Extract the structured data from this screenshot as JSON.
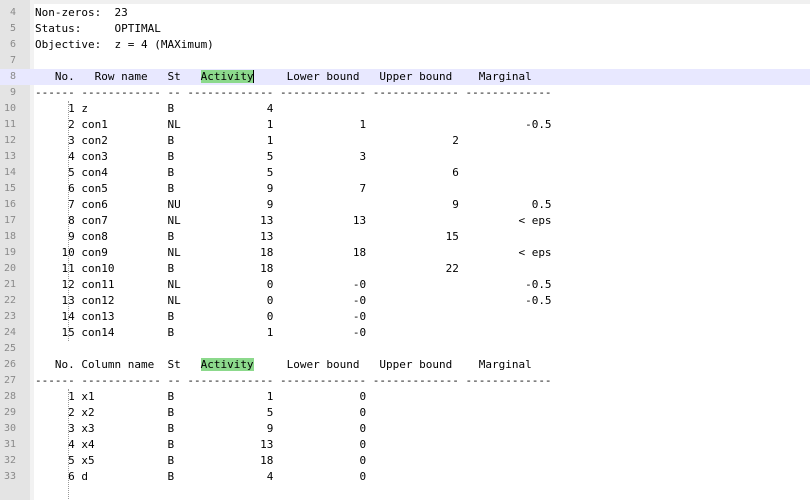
{
  "editor": {
    "header_lines": [
      {
        "n": "4",
        "text": "Non-zeros:  23"
      },
      {
        "n": "5",
        "text": "Status:     OPTIMAL"
      },
      {
        "n": "6",
        "text": "Objective:  z = 4 (MAXimum)"
      },
      {
        "n": "7",
        "text": ""
      }
    ],
    "rows_header": {
      "n": "8",
      "before": "   No.   Row name   St   ",
      "highlight": "Activity",
      "after": "     Lower bound   Upper bound    Marginal"
    },
    "rows_sep": {
      "n": "9",
      "text": "------ ------------ -- ------------- ------------- ------------- -------------"
    },
    "row_lines": [
      {
        "n": "10",
        "text": "     1 z            B              4"
      },
      {
        "n": "11",
        "text": "     2 con1         NL             1             1                        -0.5"
      },
      {
        "n": "12",
        "text": "     3 con2         B              1                           2"
      },
      {
        "n": "13",
        "text": "     4 con3         B              5             3"
      },
      {
        "n": "14",
        "text": "     5 con4         B              5                           6"
      },
      {
        "n": "15",
        "text": "     6 con5         B              9             7"
      },
      {
        "n": "16",
        "text": "     7 con6         NU             9                           9           0.5"
      },
      {
        "n": "17",
        "text": "     8 con7         NL            13            13                       < eps"
      },
      {
        "n": "18",
        "text": "     9 con8         B             13                          15"
      },
      {
        "n": "19",
        "text": "    10 con9         NL            18            18                       < eps"
      },
      {
        "n": "20",
        "text": "    11 con10        B             18                          22"
      },
      {
        "n": "21",
        "text": "    12 con11        NL             0            -0                        -0.5"
      },
      {
        "n": "22",
        "text": "    13 con12        NL             0            -0                        -0.5"
      },
      {
        "n": "23",
        "text": "    14 con13        B              0            -0"
      },
      {
        "n": "24",
        "text": "    15 con14        B              1            -0"
      },
      {
        "n": "25",
        "text": ""
      }
    ],
    "cols_header": {
      "n": "26",
      "before": "   No. Column name  St   ",
      "highlight": "Activity",
      "after": "     Lower bound   Upper bound    Marginal"
    },
    "cols_sep": {
      "n": "27",
      "text": "------ ------------ -- ------------- ------------- ------------- -------------"
    },
    "col_lines": [
      {
        "n": "28",
        "text": "     1 x1           B              1             0"
      },
      {
        "n": "29",
        "text": "     2 x2           B              5             0"
      },
      {
        "n": "30",
        "text": "     3 x3           B              9             0"
      },
      {
        "n": "31",
        "text": "     4 x4           B             13             0"
      },
      {
        "n": "32",
        "text": "     5 x5           B             18             0"
      },
      {
        "n": "33",
        "text": "     6 d            B              4             0"
      }
    ],
    "highlight_color": "#8cd98c",
    "current_line_color": "#e8e8ff"
  }
}
